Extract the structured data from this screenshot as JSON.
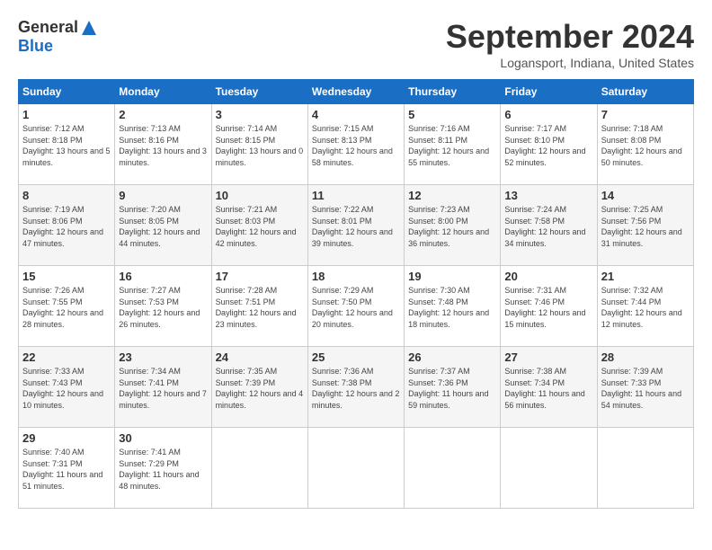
{
  "header": {
    "logo_general": "General",
    "logo_blue": "Blue",
    "month_title": "September 2024",
    "location": "Logansport, Indiana, United States"
  },
  "calendar": {
    "days_of_week": [
      "Sunday",
      "Monday",
      "Tuesday",
      "Wednesday",
      "Thursday",
      "Friday",
      "Saturday"
    ],
    "weeks": [
      [
        null,
        null,
        null,
        null,
        null,
        null,
        null
      ]
    ],
    "cells": [
      {
        "day": null
      },
      {
        "day": null
      },
      {
        "day": null
      },
      {
        "day": null
      },
      {
        "day": null
      },
      {
        "day": null
      },
      {
        "day": null
      }
    ]
  }
}
